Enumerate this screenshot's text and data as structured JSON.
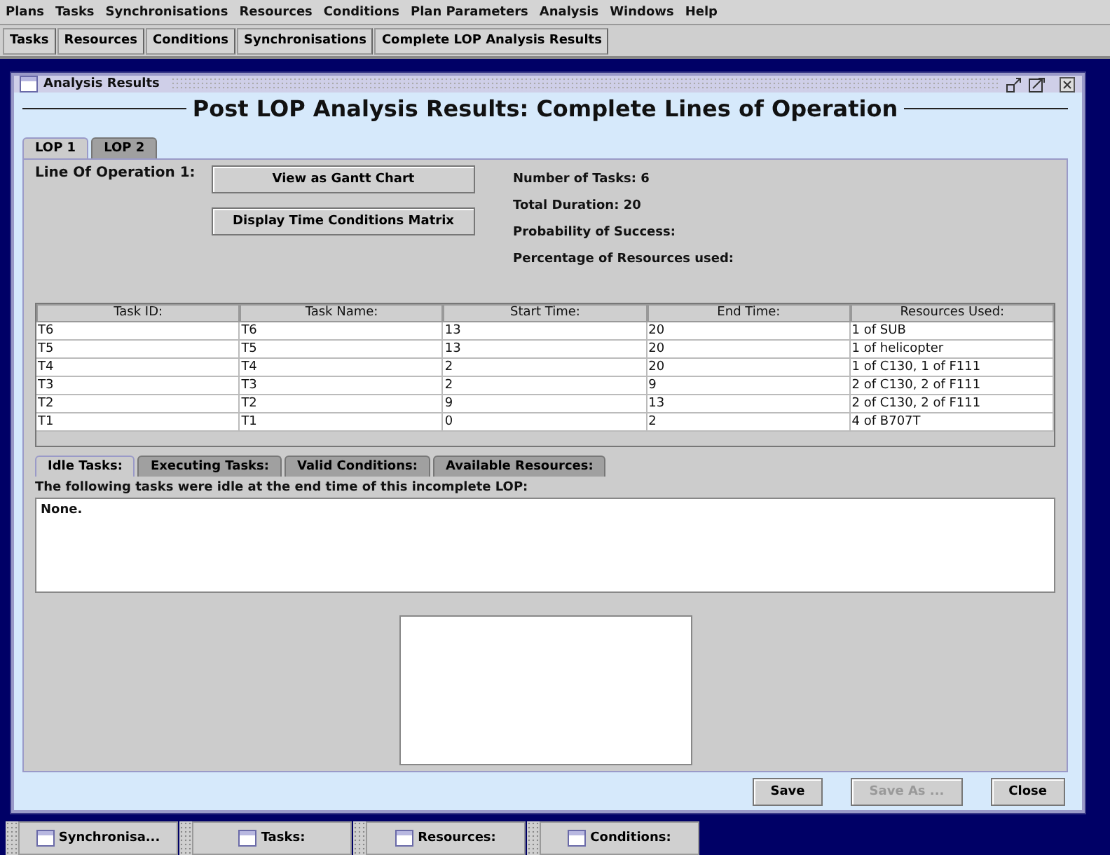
{
  "menu": [
    "Plans",
    "Tasks",
    "Synchronisations",
    "Resources",
    "Conditions",
    "Plan Parameters",
    "Analysis",
    "Windows",
    "Help"
  ],
  "toolbar": [
    "Tasks",
    "Resources",
    "Conditions",
    "Synchronisations",
    "Complete LOP Analysis Results"
  ],
  "window": {
    "title": "Analysis Results",
    "heading": "Post LOP Analysis Results: Complete Lines of Operation"
  },
  "lop_tabs": [
    {
      "label": "LOP 1",
      "selected": true
    },
    {
      "label": "LOP 2",
      "selected": false
    }
  ],
  "line_label": "Line Of Operation 1:",
  "actions": [
    "View as Gantt Chart",
    "Display Time Conditions Matrix"
  ],
  "stats": [
    "Number of Tasks: 6",
    "Total Duration: 20",
    "Probability of Success:",
    "Percentage of Resources used:"
  ],
  "table": {
    "columns": [
      "Task ID:",
      "Task Name:",
      "Start Time:",
      "End Time:",
      "Resources Used:"
    ],
    "rows": [
      [
        "T6",
        "T6",
        "13",
        "20",
        "1 of SUB"
      ],
      [
        "T5",
        "T5",
        "13",
        "20",
        "1 of helicopter"
      ],
      [
        "T4",
        "T4",
        "2",
        "20",
        "1 of C130, 1 of F111"
      ],
      [
        "T3",
        "T3",
        "2",
        "9",
        "2 of C130, 2 of F111"
      ],
      [
        "T2",
        "T2",
        "9",
        "13",
        "2 of C130, 2 of F111"
      ],
      [
        "T1",
        "T1",
        "0",
        "2",
        "4 of B707T"
      ]
    ]
  },
  "detail_tabs": [
    {
      "label": "Idle Tasks:",
      "selected": true
    },
    {
      "label": "Executing Tasks:",
      "selected": false
    },
    {
      "label": "Valid Conditions:",
      "selected": false
    },
    {
      "label": "Available Resources:",
      "selected": false
    }
  ],
  "detail_caption": "The following tasks were idle at the end time of this incomplete LOP:",
  "detail_text": "None.",
  "buttons": [
    {
      "label": "Save",
      "disabled": false
    },
    {
      "label": "Save As ...",
      "disabled": true
    },
    {
      "label": "Close",
      "disabled": false
    }
  ],
  "taskbar": [
    "Synchronisa...",
    "Tasks:",
    "Resources:",
    "Conditions:"
  ]
}
